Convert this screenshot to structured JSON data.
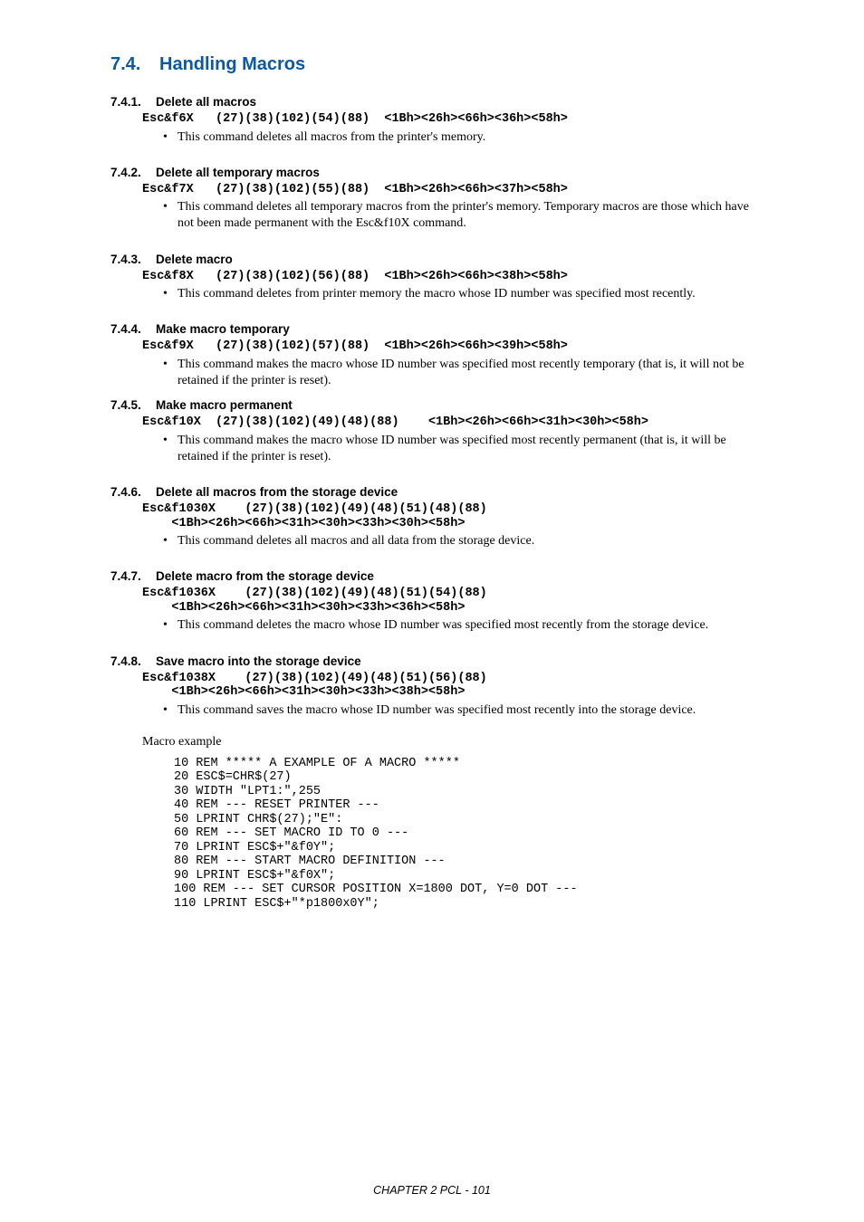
{
  "title": {
    "num": "7.4.",
    "text": "Handling Macros"
  },
  "sections": [
    {
      "num": "7.4.1.",
      "heading": "Delete all macros",
      "code": "Esc&f6X   (27)(38)(102)(54)(88)  <1Bh><26h><66h><36h><58h>",
      "bullet": "This command deletes all macros from the printer's memory."
    },
    {
      "num": "7.4.2.",
      "heading": "Delete all temporary macros",
      "code": "Esc&f7X   (27)(38)(102)(55)(88)  <1Bh><26h><66h><37h><58h>",
      "bullet": "This command deletes all temporary macros from the printer's memory. Temporary macros are those which have not been made permanent with the Esc&f10X command."
    },
    {
      "num": "7.4.3.",
      "heading": "Delete macro",
      "code": "Esc&f8X   (27)(38)(102)(56)(88)  <1Bh><26h><66h><38h><58h>",
      "bullet": "This command deletes from printer memory the macro whose ID number was specified most recently."
    },
    {
      "num": "7.4.4.",
      "heading": "Make macro temporary",
      "code": "Esc&f9X   (27)(38)(102)(57)(88)  <1Bh><26h><66h><39h><58h>",
      "bullet": "This command makes the macro whose ID number was specified most recently temporary (that is, it will not be retained if the printer is reset)."
    },
    {
      "num": "7.4.5.",
      "heading": "Make macro permanent",
      "code": "Esc&f10X  (27)(38)(102)(49)(48)(88)    <1Bh><26h><66h><31h><30h><58h>",
      "bullet": "This command makes the macro whose ID number was specified most recently permanent (that is, it will be retained if the printer is reset)."
    },
    {
      "num": "7.4.6.",
      "heading": "Delete all macros from the storage device",
      "code": "Esc&f1030X    (27)(38)(102)(49)(48)(51)(48)(88)\n    <1Bh><26h><66h><31h><30h><33h><30h><58h>",
      "bullet": "This command deletes all macros and all data from the storage device."
    },
    {
      "num": "7.4.7.",
      "heading": "Delete macro from the storage device",
      "code": "Esc&f1036X    (27)(38)(102)(49)(48)(51)(54)(88)\n    <1Bh><26h><66h><31h><30h><33h><36h><58h>",
      "bullet": "This command deletes the macro whose ID number was specified most recently from the storage device."
    },
    {
      "num": "7.4.8.",
      "heading": "Save macro into the storage device",
      "code": "Esc&f1038X    (27)(38)(102)(49)(48)(51)(56)(88)\n    <1Bh><26h><66h><31h><30h><33h><38h><58h>",
      "bullet": "This command saves the macro whose ID number was specified most recently into the storage device."
    }
  ],
  "example_label": "Macro example",
  "example_code": "10 REM ***** A EXAMPLE OF A MACRO *****\n20 ESC$=CHR$(27)\n30 WIDTH \"LPT1:\",255\n40 REM --- RESET PRINTER ---\n50 LPRINT CHR$(27);\"E\":\n60 REM --- SET MACRO ID TO 0 ---\n70 LPRINT ESC$+\"&f0Y\";\n80 REM --- START MACRO DEFINITION ---\n90 LPRINT ESC$+\"&f0X\";\n100 REM --- SET CURSOR POSITION X=1800 DOT, Y=0 DOT ---\n110 LPRINT ESC$+\"*p1800x0Y\";",
  "footer": "CHAPTER 2 PCL - 101"
}
